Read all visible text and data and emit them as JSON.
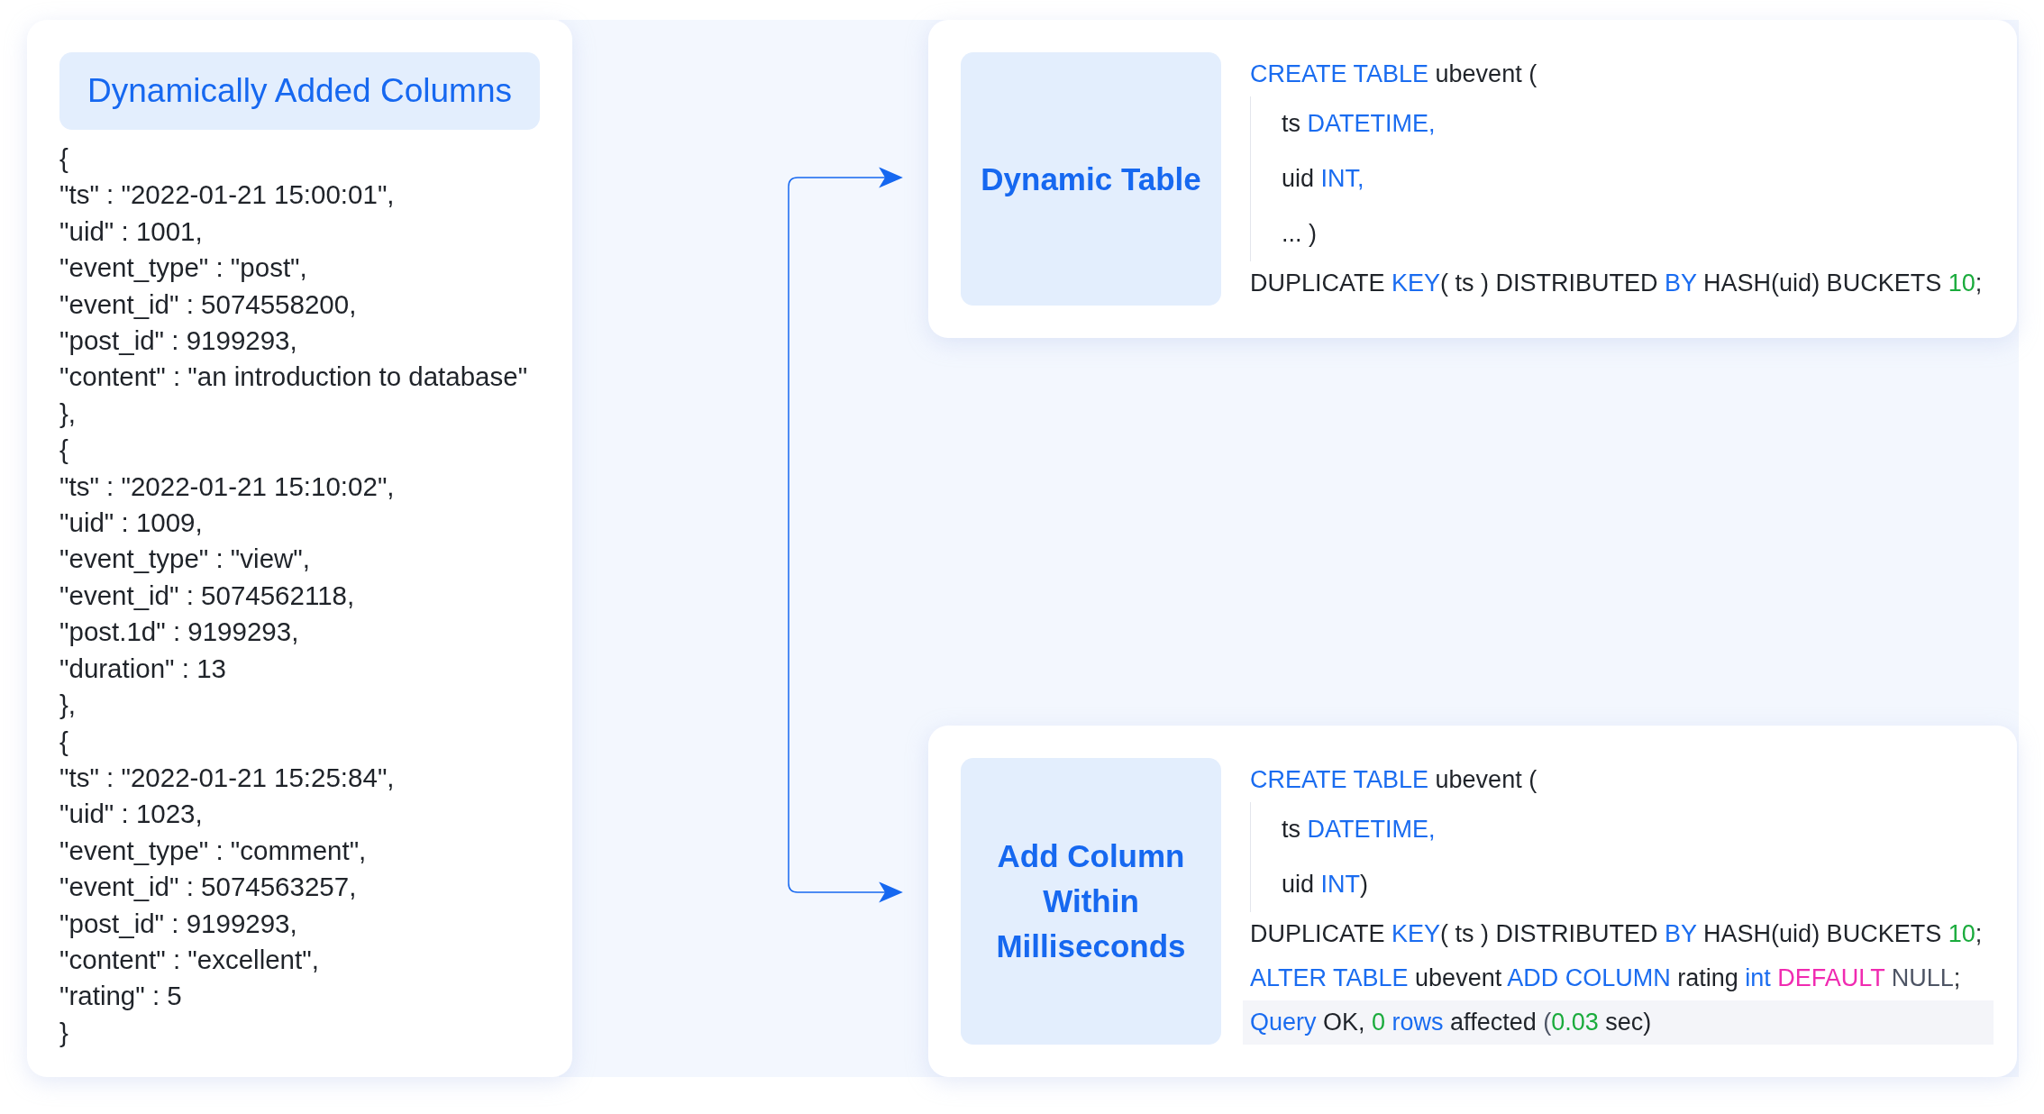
{
  "source_card": {
    "title": "Dynamically Added Columns",
    "lines": [
      "{",
      "\"ts\" : \"2022-01-21 15:00:01\",",
      "\"uid\" : 1001,",
      "\"event_type\" : \"post\",",
      "\"event_id\" : 5074558200,",
      "\"post_id\" : 9199293,",
      "\"content\" : \"an introduction to database\"",
      "},",
      "{",
      "\"ts\" : \"2022-01-21 15:10:02\",",
      "\"uid\" : 1009,",
      "\"event_type\" : \"view\",",
      "\"event_id\" : 5074562118,",
      "\"post.1d\" : 9199293,",
      "\"duration\" : 13",
      "},",
      "{",
      "\"ts\" : \"2022-01-21 15:25:84\",",
      "\"uid\" : 1023,",
      "\"event_type\" : \"comment\",",
      "\"event_id\" : 5074563257,",
      "\"post_id\" : 9199293,",
      "\"content\" : \"excellent\",",
      "\"rating\" : 5",
      "}"
    ]
  },
  "cards": [
    {
      "label": "Dynamic Table",
      "lines": [
        {
          "indented": false,
          "highlighted": false,
          "tokens": [
            {
              "text": "CREATE TABLE",
              "kind": "keyword"
            },
            {
              "text": " ubevent (",
              "kind": "plain"
            }
          ]
        },
        {
          "indented": true,
          "highlighted": false,
          "tokens": [
            {
              "text": "ts ",
              "kind": "plain"
            },
            {
              "text": "DATETIME,",
              "kind": "keyword"
            }
          ]
        },
        {
          "indented": true,
          "highlighted": false,
          "tokens": [
            {
              "text": "uid ",
              "kind": "plain"
            },
            {
              "text": "INT,",
              "kind": "keyword"
            }
          ]
        },
        {
          "indented": true,
          "highlighted": false,
          "tokens": [
            {
              "text": "... )",
              "kind": "plain"
            }
          ]
        },
        {
          "indented": false,
          "highlighted": false,
          "tokens": [
            {
              "text": "DUPLICATE ",
              "kind": "plain"
            },
            {
              "text": "KEY",
              "kind": "keyword"
            },
            {
              "text": "( ts ) DISTRIBUTED ",
              "kind": "plain"
            },
            {
              "text": "BY",
              "kind": "keyword"
            },
            {
              "text": " HASH(uid) BUCKETS ",
              "kind": "plain"
            },
            {
              "text": "10",
              "kind": "number"
            },
            {
              "text": ";",
              "kind": "plain"
            }
          ]
        }
      ]
    },
    {
      "label": "Add Column Within Milliseconds",
      "lines": [
        {
          "indented": false,
          "highlighted": false,
          "tokens": [
            {
              "text": "CREATE TABLE",
              "kind": "keyword"
            },
            {
              "text": " ubevent (",
              "kind": "plain"
            }
          ]
        },
        {
          "indented": true,
          "highlighted": false,
          "tokens": [
            {
              "text": "ts ",
              "kind": "plain"
            },
            {
              "text": "DATETIME,",
              "kind": "keyword"
            }
          ]
        },
        {
          "indented": true,
          "highlighted": false,
          "tokens": [
            {
              "text": "uid ",
              "kind": "plain"
            },
            {
              "text": "INT",
              "kind": "keyword"
            },
            {
              "text": ")",
              "kind": "plain"
            }
          ]
        },
        {
          "indented": false,
          "highlighted": false,
          "tokens": [
            {
              "text": "DUPLICATE ",
              "kind": "plain"
            },
            {
              "text": "KEY",
              "kind": "keyword"
            },
            {
              "text": "( ts ) DISTRIBUTED ",
              "kind": "plain"
            },
            {
              "text": "BY",
              "kind": "keyword"
            },
            {
              "text": " HASH(uid) BUCKETS ",
              "kind": "plain"
            },
            {
              "text": "10",
              "kind": "number"
            },
            {
              "text": ";",
              "kind": "plain"
            }
          ]
        },
        {
          "indented": false,
          "highlighted": false,
          "tokens": [
            {
              "text": "ALTER TABLE",
              "kind": "keyword"
            },
            {
              "text": " ubevent ",
              "kind": "plain"
            },
            {
              "text": "ADD COLUMN",
              "kind": "keyword"
            },
            {
              "text": " rating ",
              "kind": "plain"
            },
            {
              "text": "int ",
              "kind": "keyword"
            },
            {
              "text": "DEFAULT ",
              "kind": "special"
            },
            {
              "text": "NULL",
              "kind": "muted"
            },
            {
              "text": ";",
              "kind": "plain"
            }
          ]
        },
        {
          "indented": false,
          "highlighted": true,
          "tokens": [
            {
              "text": "Query",
              "kind": "keyword"
            },
            {
              "text": " OK, ",
              "kind": "plain"
            },
            {
              "text": "0 ",
              "kind": "number"
            },
            {
              "text": "rows",
              "kind": "keyword"
            },
            {
              "text": " affected ",
              "kind": "plain"
            },
            {
              "text": "(",
              "kind": "muted"
            },
            {
              "text": "0.03",
              "kind": "number"
            },
            {
              "text": " sec)",
              "kind": "plain"
            }
          ]
        }
      ]
    }
  ]
}
